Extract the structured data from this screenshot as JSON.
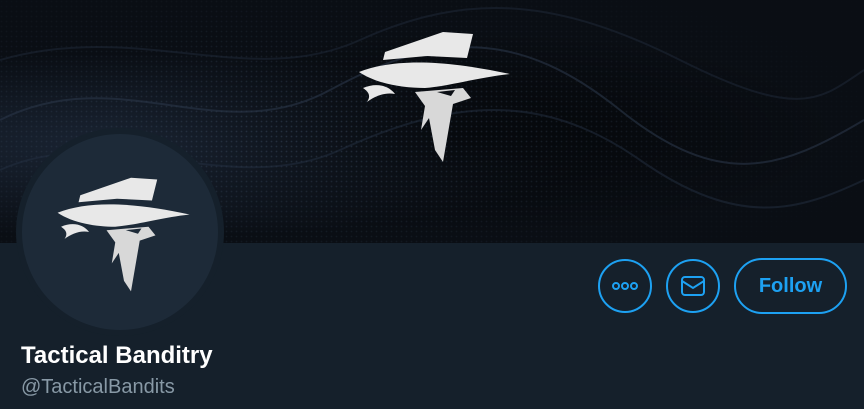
{
  "profile": {
    "display_name": "Tactical Banditry",
    "handle": "@TacticalBandits"
  },
  "actions": {
    "more_icon": "more-horizontal-icon",
    "message_icon": "envelope-icon",
    "follow_label": "Follow"
  },
  "colors": {
    "background": "#15202b",
    "accent": "#1da1f2",
    "name_text": "#ffffff",
    "handle_text": "#8899a6"
  }
}
